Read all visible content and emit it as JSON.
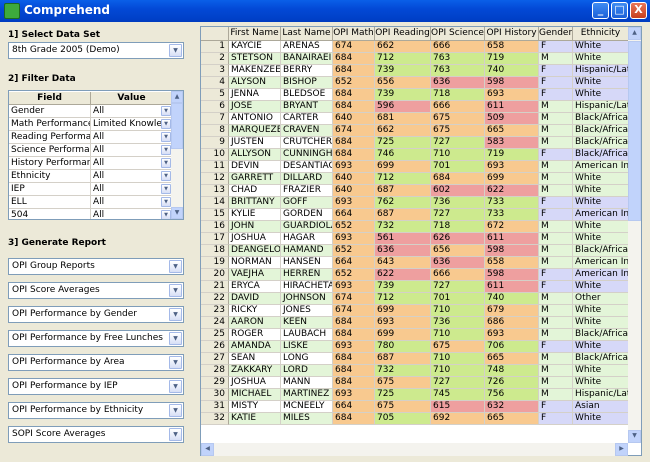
{
  "window": {
    "title": "Comprehend",
    "minimize": "_",
    "maximize": "□",
    "close": "X"
  },
  "left": {
    "select_label": "1] Select Data Set",
    "dataset": "8th Grade 2005 (Demo)",
    "filter_label": "2] Filter Data",
    "filter_headers": [
      "Field",
      "Value"
    ],
    "filters": [
      {
        "field": "Gender",
        "value": "All"
      },
      {
        "field": "Math Performance",
        "value": "Limited Knowledge"
      },
      {
        "field": "Reading Performance",
        "value": "All"
      },
      {
        "field": "Science Performance",
        "value": "All"
      },
      {
        "field": "History Performance",
        "value": "All"
      },
      {
        "field": "Ethnicity",
        "value": "All"
      },
      {
        "field": "IEP",
        "value": "All"
      },
      {
        "field": "ELL",
        "value": "All"
      },
      {
        "field": "504",
        "value": "All"
      }
    ],
    "report_label": "3] Generate Report",
    "reports": [
      "OPI Group Reports",
      "OPI Score Averages",
      "OPI Performance by Gender",
      "OPI Performance by Free Lunches",
      "OPI Performance by Area",
      "OPI Performance by IEP",
      "OPI Performance by Ethnicity",
      "SOPI Score Averages"
    ]
  },
  "grid": {
    "headers": [
      "First Name",
      "Last Name",
      "OPI Math",
      "OPI Reading",
      "OPI Science",
      "OPI History",
      "Gender",
      "Ethnicity"
    ],
    "colors": {
      "orange": "#F8C98F",
      "green": "#CDEA8E",
      "red": "#EE9F9F",
      "blue": "#D6D8F8",
      "lightgreen": "#E3F5D8"
    },
    "rows": [
      {
        "n": "1",
        "fn": "KAYCIE",
        "ln": "ARENAS",
        "m": "674",
        "r": "662",
        "s": "666",
        "h": "658",
        "g": "F",
        "e": "White"
      },
      {
        "n": "2",
        "fn": "STETSON",
        "ln": "BANAIRAEI",
        "m": "684",
        "r": "712",
        "s": "763",
        "h": "719",
        "g": "M",
        "e": "White"
      },
      {
        "n": "3",
        "fn": "MAKENZEE",
        "ln": "BERRY",
        "m": "684",
        "r": "739",
        "s": "763",
        "h": "740",
        "g": "F",
        "e": "Hispanic/Latino"
      },
      {
        "n": "4",
        "fn": "ALYSON",
        "ln": "BISHOP",
        "m": "652",
        "r": "656",
        "s": "636",
        "h": "598",
        "g": "F",
        "e": "White"
      },
      {
        "n": "5",
        "fn": "JENNA",
        "ln": "BLEDSOE",
        "m": "684",
        "r": "739",
        "s": "718",
        "h": "693",
        "g": "F",
        "e": "White"
      },
      {
        "n": "6",
        "fn": "JOSE",
        "ln": "BRYANT",
        "m": "684",
        "r": "596",
        "s": "666",
        "h": "611",
        "g": "M",
        "e": "Hispanic/Latino"
      },
      {
        "n": "7",
        "fn": "ANTONIO",
        "ln": "CARTER",
        "m": "640",
        "r": "681",
        "s": "675",
        "h": "509",
        "g": "M",
        "e": "Black/African"
      },
      {
        "n": "8",
        "fn": "MARQUEZE",
        "ln": "CRAVEN",
        "m": "674",
        "r": "662",
        "s": "675",
        "h": "665",
        "g": "M",
        "e": "Black/African"
      },
      {
        "n": "9",
        "fn": "JUSTEN",
        "ln": "CRUTCHER",
        "m": "684",
        "r": "725",
        "s": "727",
        "h": "583",
        "g": "M",
        "e": "Black/African"
      },
      {
        "n": "10",
        "fn": "ALLYSON",
        "ln": "CUNNINGHAM",
        "m": "684",
        "r": "746",
        "s": "710",
        "h": "719",
        "g": "F",
        "e": "Black/African"
      },
      {
        "n": "11",
        "fn": "DEVIN",
        "ln": "DESANTIAGO",
        "m": "693",
        "r": "699",
        "s": "701",
        "h": "693",
        "g": "M",
        "e": "American Indian"
      },
      {
        "n": "12",
        "fn": "GARRETT",
        "ln": "DILLARD",
        "m": "640",
        "r": "712",
        "s": "684",
        "h": "699",
        "g": "M",
        "e": "White"
      },
      {
        "n": "13",
        "fn": "CHAD",
        "ln": "FRAZIER",
        "m": "640",
        "r": "687",
        "s": "602",
        "h": "622",
        "g": "M",
        "e": "White"
      },
      {
        "n": "14",
        "fn": "BRITTANY",
        "ln": "GOFF",
        "m": "693",
        "r": "762",
        "s": "736",
        "h": "733",
        "g": "F",
        "e": "White"
      },
      {
        "n": "15",
        "fn": "KYLIE",
        "ln": "GORDEN",
        "m": "664",
        "r": "687",
        "s": "727",
        "h": "733",
        "g": "F",
        "e": "American Indian"
      },
      {
        "n": "16",
        "fn": "JOHN",
        "ln": "GUARDIOLA",
        "m": "652",
        "r": "732",
        "s": "718",
        "h": "672",
        "g": "M",
        "e": "White"
      },
      {
        "n": "17",
        "fn": "JOSHUA",
        "ln": "HAGAR",
        "m": "693",
        "r": "561",
        "s": "626",
        "h": "611",
        "g": "M",
        "e": "White"
      },
      {
        "n": "18",
        "fn": "DEANGELO",
        "ln": "HAMAND",
        "m": "652",
        "r": "636",
        "s": "656",
        "h": "598",
        "g": "M",
        "e": "Black/African"
      },
      {
        "n": "19",
        "fn": "NORMAN",
        "ln": "HANSEN",
        "m": "664",
        "r": "643",
        "s": "636",
        "h": "658",
        "g": "M",
        "e": "American Indian"
      },
      {
        "n": "20",
        "fn": "VAEJHA",
        "ln": "HERREN",
        "m": "652",
        "r": "622",
        "s": "666",
        "h": "598",
        "g": "F",
        "e": "American Indian"
      },
      {
        "n": "21",
        "fn": "ERYCA",
        "ln": "HIRACHETA",
        "m": "693",
        "r": "739",
        "s": "727",
        "h": "611",
        "g": "F",
        "e": "White"
      },
      {
        "n": "22",
        "fn": "DAVID",
        "ln": "JOHNSON",
        "m": "674",
        "r": "712",
        "s": "701",
        "h": "740",
        "g": "M",
        "e": "Other"
      },
      {
        "n": "23",
        "fn": "RICKY",
        "ln": "JONES",
        "m": "674",
        "r": "699",
        "s": "710",
        "h": "679",
        "g": "M",
        "e": "White"
      },
      {
        "n": "24",
        "fn": "AARON",
        "ln": "KEEN",
        "m": "684",
        "r": "693",
        "s": "736",
        "h": "686",
        "g": "M",
        "e": "White"
      },
      {
        "n": "25",
        "fn": "ROGER",
        "ln": "LAUBACH",
        "m": "684",
        "r": "699",
        "s": "710",
        "h": "693",
        "g": "M",
        "e": "Black/African"
      },
      {
        "n": "26",
        "fn": "AMANDA",
        "ln": "LISKE",
        "m": "693",
        "r": "780",
        "s": "675",
        "h": "706",
        "g": "F",
        "e": "White"
      },
      {
        "n": "27",
        "fn": "SEAN",
        "ln": "LONG",
        "m": "684",
        "r": "687",
        "s": "710",
        "h": "665",
        "g": "M",
        "e": "Black/African"
      },
      {
        "n": "28",
        "fn": "ZAKKARY",
        "ln": "LORD",
        "m": "684",
        "r": "732",
        "s": "710",
        "h": "748",
        "g": "M",
        "e": "White"
      },
      {
        "n": "29",
        "fn": "JOSHUA",
        "ln": "MANN",
        "m": "684",
        "r": "675",
        "s": "727",
        "h": "726",
        "g": "M",
        "e": "White"
      },
      {
        "n": "30",
        "fn": "MICHAEL",
        "ln": "MARTINEZ",
        "m": "693",
        "r": "725",
        "s": "745",
        "h": "756",
        "g": "M",
        "e": "Hispanic/Latino"
      },
      {
        "n": "31",
        "fn": "MISTY",
        "ln": "MCNEELY",
        "m": "664",
        "r": "675",
        "s": "615",
        "h": "632",
        "g": "F",
        "e": "Asian"
      },
      {
        "n": "32",
        "fn": "KATIE",
        "ln": "MILES",
        "m": "684",
        "r": "705",
        "s": "692",
        "h": "665",
        "g": "F",
        "e": "White"
      }
    ]
  }
}
